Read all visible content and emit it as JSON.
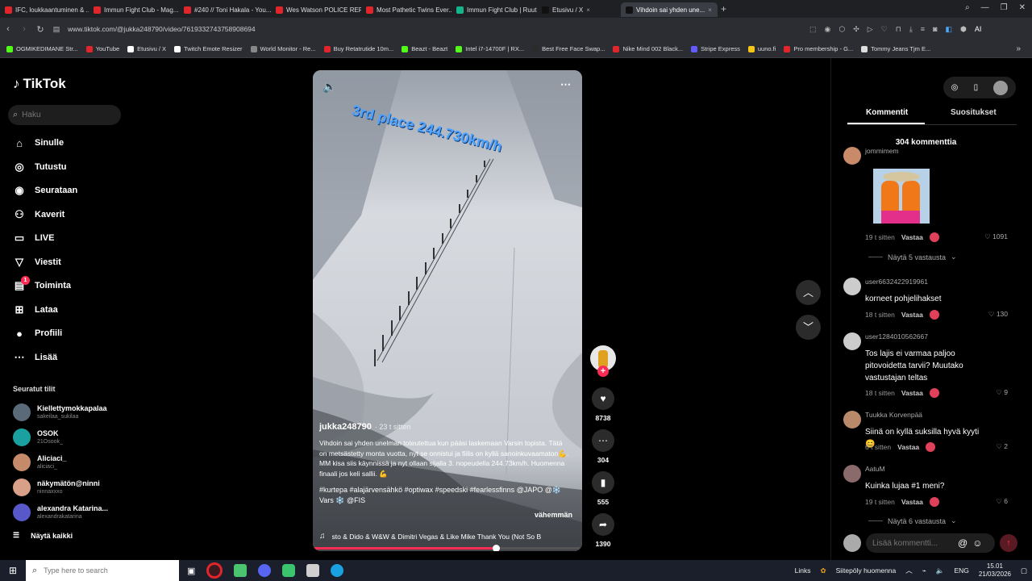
{
  "browser": {
    "tabs": [
      {
        "title": "IFC, loukkaantuminen & ...",
        "color": "#e0262b"
      },
      {
        "title": "Immun Fight Club - Mag...",
        "color": "#e0262b"
      },
      {
        "title": "#240 // Toni Hakala - You...",
        "color": "#e0262b"
      },
      {
        "title": "Wes Watson POLICE REPO...",
        "color": "#e0262b"
      },
      {
        "title": "Most Pathetic Twins Ever...",
        "color": "#e0262b"
      },
      {
        "title": "Immun Fight Club | Ruutu",
        "color": "#13b58a"
      },
      {
        "title": "Etusivu / X",
        "color": "#111111"
      },
      {
        "title": "Vihdoin sai yhden une...",
        "color": "#111111"
      }
    ],
    "url": "www.tiktok.com/@jukka248790/video/7619332743758908694",
    "ai_label": "AI",
    "bookmarks": [
      {
        "label": "OGMIKEDIMANE Str...",
        "color": "#53fc18"
      },
      {
        "label": "YouTube",
        "color": "#e0262b"
      },
      {
        "label": "Etusivu / X",
        "color": "#ffffff"
      },
      {
        "label": "Twitch Emote Resizer",
        "color": "#ffffff"
      },
      {
        "label": "World Monitor - Re...",
        "color": "#888888"
      },
      {
        "label": "Buy Retatrutide 10m...",
        "color": "#e0262b"
      },
      {
        "label": "Beazt - Beazt",
        "color": "#53fc18"
      },
      {
        "label": "Intel i7-14700F | RX...",
        "color": "#53fc18"
      },
      {
        "label": "Best Free Face Swap...",
        "color": "#2a2a2a"
      },
      {
        "label": "Nike Mind 002 Black...",
        "color": "#e0262b"
      },
      {
        "label": "Stripe Express",
        "color": "#635bff"
      },
      {
        "label": "uuno.fi",
        "color": "#f5c518"
      },
      {
        "label": "Pro membership - G...",
        "color": "#e0262b"
      },
      {
        "label": "Tommy Jeans Tjm E...",
        "color": "#dddddd"
      }
    ]
  },
  "sidebar": {
    "logo": "TikTok",
    "search_placeholder": "Haku",
    "nav": [
      {
        "label": "Sinulle",
        "icon": "home-icon"
      },
      {
        "label": "Tutustu",
        "icon": "compass-icon"
      },
      {
        "label": "Seurataan",
        "icon": "following-icon"
      },
      {
        "label": "Kaverit",
        "icon": "friends-icon"
      },
      {
        "label": "LIVE",
        "icon": "live-icon"
      },
      {
        "label": "Viestit",
        "icon": "messages-icon"
      },
      {
        "label": "Toiminta",
        "icon": "activity-icon",
        "badge": "1"
      },
      {
        "label": "Lataa",
        "icon": "upload-icon"
      },
      {
        "label": "Profiili",
        "icon": "profile-icon"
      },
      {
        "label": "Lisää",
        "icon": "more-icon"
      }
    ],
    "followed_title": "Seuratut tilit",
    "followed": [
      {
        "name": "Kiellettymokkapalaa",
        "handle": "sakeilaa_sukilaa",
        "color": "#5a6a78"
      },
      {
        "name": "OSOK",
        "handle": "21Osook_",
        "color": "#1aa0a0"
      },
      {
        "name": "Aliciaci_",
        "handle": "aliciaci_",
        "color": "#c48a6a"
      },
      {
        "name": "näkymätön@ninni",
        "handle": "ninnaxxxo",
        "color": "#d8a088"
      },
      {
        "name": "alexandra Katarina...",
        "handle": "alexandrakatarina",
        "color": "#5858c8"
      }
    ],
    "show_all": "Näytä kaikki"
  },
  "video": {
    "overlay_text": "3rd place 244.730km/h",
    "author": "jukka248790",
    "time": "· 23 t sitten",
    "caption": "Vihdoin sai yhden unelman toteutettua kun pääsi laskemaan Varsin topista. Tätä on metsästetty monta vuotta, nyt se onnistui ja fiilis on kyllä sanoinkuvaamaton💪. MM kisa siis käynnissä ja nyt ollaan sijalla 3. nopeudella 244.73km/h. Huomenna finaali jos keli sallii. 💪",
    "hashtags": "#kurtepa #alajärvensähkö #optiwax #speedski #fearlessfinns @JAPO @❄️ Vars ❄️ @FIS",
    "less": "vähemmän",
    "music": "sto & Dido & W&W & Dimitri Vegas & Like Mike  Thank You (Not So B",
    "progress": 0.68
  },
  "actions": {
    "likes": "8738",
    "comments": "304",
    "saves": "555",
    "shares": "1390"
  },
  "comments_panel": {
    "tab_comments": "Kommentit",
    "tab_recs": "Suositukset",
    "count": "304 kommenttia",
    "reply_label": "Vastaa",
    "comments": [
      {
        "user": "jommimem",
        "text": "",
        "time": "19 t sitten",
        "likes": "1091",
        "color": "#c98a6a",
        "replies": "Näytä 5 vastausta"
      },
      {
        "user": "user6632422919961",
        "text": "korneet pohjelihakset",
        "time": "18 t sitten",
        "likes": "130",
        "color": "#cccccc",
        "replies": ""
      },
      {
        "user": "user1284010562667",
        "text": "Tos lajis ei varmaa paljoo pitovoidetta tarvii? Muutako vastustajan teltas",
        "time": "18 t sitten",
        "likes": "9",
        "color": "#cccccc",
        "replies": ""
      },
      {
        "user": "Tuukka Korvenpää",
        "text": "Siinä on kyllä suksilla hyvä kyyti 😊",
        "time": "6 t sitten",
        "likes": "2",
        "color": "#b88a6a",
        "replies": ""
      },
      {
        "user": "AatuM",
        "text": "Kuinka lujaa #1 meni?",
        "time": "19 t sitten",
        "likes": "6",
        "color": "#8a6a6a",
        "replies": "Näytä 6 vastausta"
      }
    ],
    "input_placeholder": "Lisää kommentti..."
  },
  "taskbar": {
    "search_placeholder": "Type here to search",
    "links": "Links",
    "weather": "Siitepöly huomenna",
    "lang": "ENG",
    "time": "15.01",
    "date": "21/03/2026"
  },
  "colors": {
    "accent": "#fe2c55",
    "background": "#000000"
  }
}
